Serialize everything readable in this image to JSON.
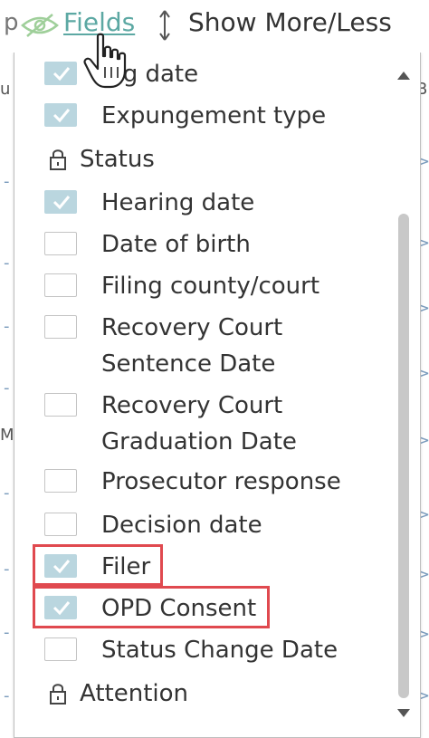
{
  "toolbar": {
    "fields_label": "Fields",
    "show_more_less_label": "Show More/Less"
  },
  "fields_menu": {
    "items": [
      {
        "label": "ing date",
        "checked": true
      },
      {
        "label": "Expungement type",
        "checked": true
      },
      {
        "group": "Status",
        "locked": true
      },
      {
        "label": "Hearing date",
        "checked": true
      },
      {
        "label": "Date of birth",
        "checked": false
      },
      {
        "label": "Filing county/court",
        "checked": false
      },
      {
        "label_lines": [
          "Recovery Court",
          "Sentence Date"
        ],
        "checked": false
      },
      {
        "label_lines": [
          "Recovery Court",
          "Graduation Date"
        ],
        "checked": false
      },
      {
        "label": "Prosecutor response",
        "checked": false
      },
      {
        "label": "Decision date",
        "checked": false
      },
      {
        "label": "Filer",
        "checked": true,
        "highlighted": true
      },
      {
        "label": "OPD Consent",
        "checked": true,
        "highlighted": true
      },
      {
        "label": "Status Change Date",
        "checked": false
      },
      {
        "group": "Attention",
        "locked": true
      }
    ]
  },
  "colors": {
    "accent_link": "#5ca8a3",
    "checkbox_checked": "#bad6df",
    "highlight_box": "#e0494f",
    "text": "#333333"
  },
  "icons": [
    "eye-slash-icon",
    "arrows-up-down-icon",
    "hand-pointer-icon",
    "lock-icon",
    "check-icon",
    "scroll-up-arrow-icon",
    "scroll-down-arrow-icon"
  ]
}
